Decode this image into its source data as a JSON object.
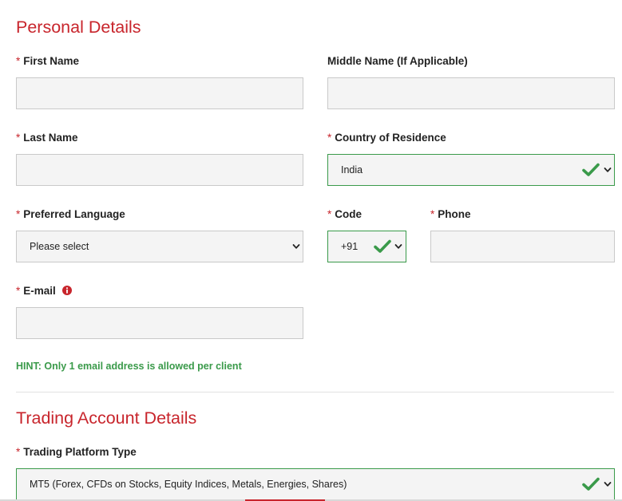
{
  "personal": {
    "title": "Personal Details",
    "required_mark": "*",
    "first_name": {
      "label": "First Name",
      "value": ""
    },
    "middle_name": {
      "label": "Middle Name (If Applicable)",
      "value": ""
    },
    "last_name": {
      "label": "Last Name",
      "value": ""
    },
    "country": {
      "label": "Country of Residence",
      "value": "India",
      "valid": true
    },
    "language": {
      "label": "Preferred Language",
      "value": "Please select"
    },
    "code": {
      "label": "Code",
      "value": "+91",
      "valid": true
    },
    "phone": {
      "label": "Phone",
      "value": ""
    },
    "email": {
      "label": "E-mail",
      "value": "",
      "icon": "info-icon"
    },
    "hint": "HINT: Only 1 email address is allowed per client"
  },
  "trading": {
    "title": "Trading Account Details",
    "required_mark": "*",
    "platform": {
      "label": "Trading Platform Type",
      "value": "MT5 (Forex, CFDs on Stocks, Equity Indices, Metals, Energies, Shares)",
      "valid": true
    }
  },
  "colors": {
    "accent": "#c8252c",
    "valid": "#3a9a4a",
    "field_bg": "#f4f4f4",
    "field_border": "#c9c9c9"
  }
}
